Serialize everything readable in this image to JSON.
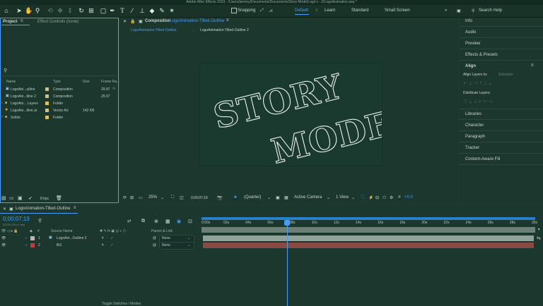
{
  "window": {
    "title": "Adobe After Effects 2023 - /Users/jeremy/Documents/Documents/Story Mode/Logo's - 2/LogoAnimation.aep *"
  },
  "toolbar": {
    "snapping_label": "Snapping",
    "workspaces": [
      "Default",
      "Learn",
      "Standard",
      "Small Screen"
    ],
    "active_workspace": "Default",
    "search_placeholder": "Search Help"
  },
  "project_panel": {
    "tab_project": "Project",
    "tab_effect_controls": "Effect Controls (none)",
    "columns": [
      "Name",
      "Type",
      "Size",
      "Frame Ra..."
    ],
    "items": [
      {
        "name": "LogoAni...utline",
        "type": "Composition",
        "size": "",
        "fps": "29.97"
      },
      {
        "name": "LogoAni...tline 2",
        "type": "Composition",
        "size": "",
        "fps": "29.97"
      },
      {
        "name": "LogoAni... Layers",
        "type": "Folder",
        "size": "",
        "fps": ""
      },
      {
        "name": "LogoAni...tline.ai",
        "type": "Vector Art",
        "size": "142 KB",
        "fps": ""
      },
      {
        "name": "Solids",
        "type": "Folder",
        "size": "",
        "fps": ""
      }
    ],
    "bpc": "8 bpc"
  },
  "composition": {
    "tab_prefix": "Composition",
    "tab_name": "LogoAnimation-Tilted-Outline",
    "breadcrumb": [
      "LogoAnimation-Tilted-Outline",
      "LogoAnimation-Tilted-Outline 2"
    ],
    "art_line1": "STORY",
    "art_line2": "MODE",
    "zoom": "25%",
    "timecode": "0;00;07;19",
    "resolution": "(Quarter)",
    "camera": "Active Camera",
    "views": "1 View",
    "exposure": "+0.0"
  },
  "right_panel": {
    "items": [
      "Info",
      "Audio",
      "Preview",
      "Effects & Presets"
    ],
    "align_title": "Align",
    "align_layers_to": "Align Layers to:",
    "align_target": "Selection",
    "distribute_layers": "Distribute Layers:",
    "items2": [
      "Libraries",
      "Character",
      "Paragraph",
      "Tracker",
      "Content-Aware Fill"
    ]
  },
  "timeline": {
    "comp_name": "LogoAnimation-Tilted-Outline",
    "timecode": "0;00;07;19",
    "fps_note": "00229 (29.97 fps)",
    "col_source": "Source Name",
    "col_parent": "Parent & Link",
    "layers": [
      {
        "num": "1",
        "name": "LogoAni...Outline 2",
        "parent": "None",
        "color": "#b9b9b9"
      },
      {
        "num": "2",
        "name": "BG",
        "parent": "None",
        "color": "#c23a3a"
      }
    ],
    "ticks": [
      "0:00s",
      "02s",
      "04s",
      "06s",
      "08s",
      "10s",
      "12s",
      "14s",
      "16s",
      "18s",
      "20s",
      "22s",
      "24s",
      "26s",
      "28s",
      "30s"
    ],
    "footer": "Toggle Switches / Modes"
  }
}
